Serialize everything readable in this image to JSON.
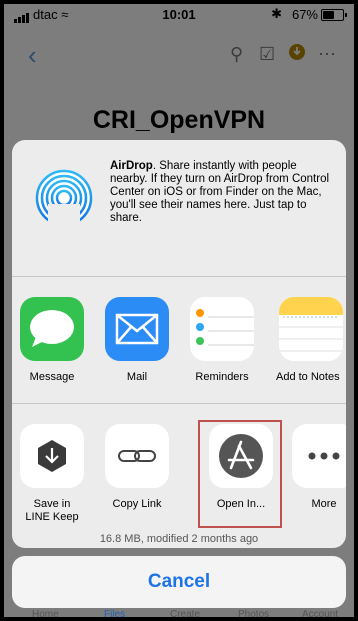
{
  "status_bar": {
    "carrier": "dtac",
    "time": "10:01",
    "battery": "67%",
    "battery_level": 0.67
  },
  "background": {
    "title": "CRI_OpenVPN",
    "file_meta": "16.8 MB, modified 2 months ago",
    "tabs": [
      "Home",
      "Files",
      "Create",
      "Photos",
      "Account"
    ]
  },
  "airdrop": {
    "title": "AirDrop",
    "text": ". Share instantly with people nearby. If they turn on AirDrop from Control Center on iOS or from Finder on the Mac, you'll see their names here. Just tap to share."
  },
  "share_apps": [
    {
      "label": "Message",
      "icon": "messages-icon",
      "color": "#33c24f"
    },
    {
      "label": "Mail",
      "icon": "mail-icon",
      "color": "#2b8cf5"
    },
    {
      "label": "Reminders",
      "icon": "reminders-icon",
      "color": "#ffffff"
    },
    {
      "label": "Add to Notes",
      "icon": "notes-icon",
      "color": "#ffd34e"
    }
  ],
  "actions": [
    {
      "label_line1": "Save in",
      "label_line2": "LINE Keep",
      "icon": "download-shield-icon"
    },
    {
      "label_line1": "Copy Link",
      "label_line2": "",
      "icon": "link-icon"
    },
    {
      "label_line1": "Open In...",
      "label_line2": "",
      "icon": "app-store-icon"
    },
    {
      "label_line1": "More",
      "label_line2": "",
      "icon": "more-dots-icon"
    }
  ],
  "cancel_label": "Cancel",
  "colors": {
    "accent": "#1e73e8",
    "highlight": "#c0504d"
  }
}
